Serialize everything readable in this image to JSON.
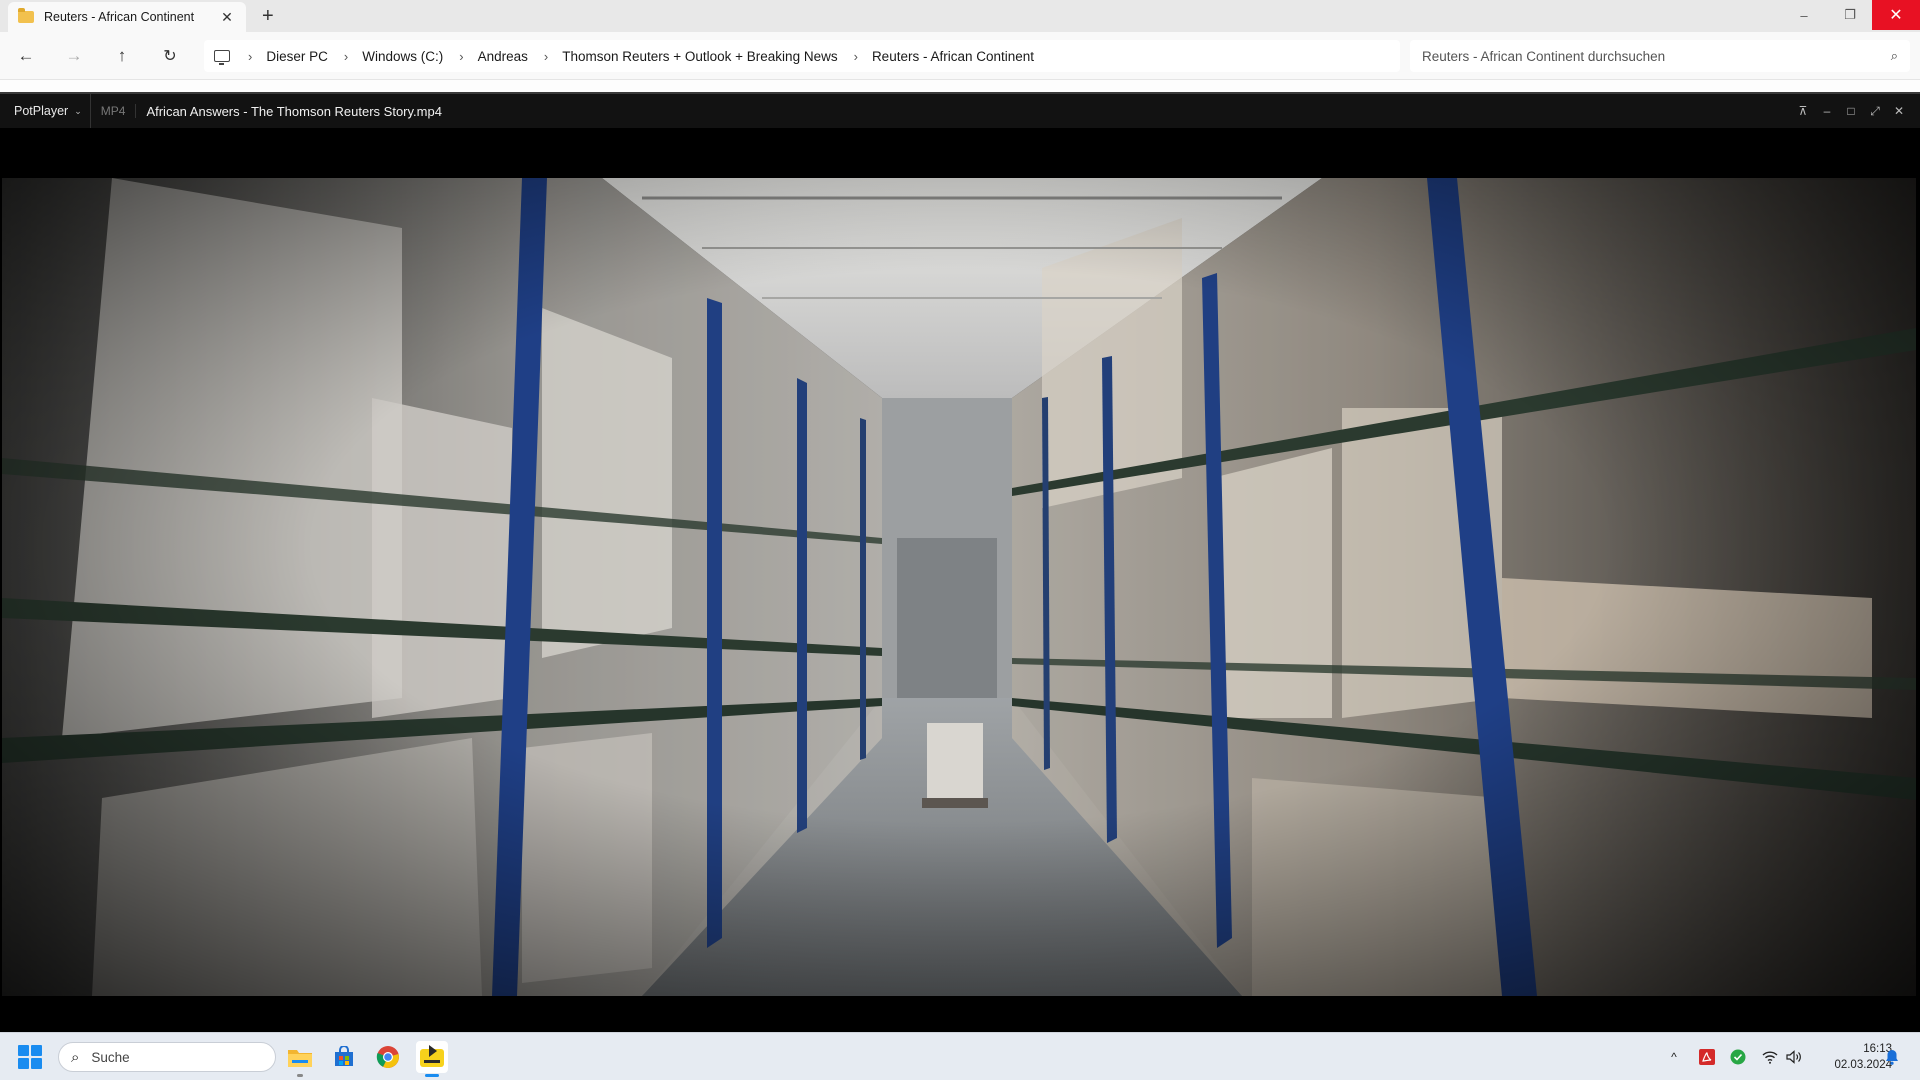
{
  "explorer": {
    "tab_title": "Reuters - African Continent",
    "tab_close": "✕",
    "new_tab": "+",
    "window_controls": {
      "minimize": "–",
      "restore": "❐",
      "close": "✕"
    },
    "nav": {
      "back": "←",
      "forward": "→",
      "up": "↑",
      "refresh": "↻"
    },
    "breadcrumb": [
      "Dieser PC",
      "Windows (C:)",
      "Andreas",
      "Thomson Reuters + Outlook + Breaking News",
      "Reuters - African Continent"
    ],
    "crumb_separator": "›",
    "search_placeholder": "Reuters - African Continent durchsuchen",
    "search_icon": "⌕"
  },
  "player": {
    "menu_label": "PotPlayer",
    "menu_chevron": "⌄",
    "format": "MP4",
    "title": "African Answers - The Thomson Reuters Story.mp4",
    "controls": {
      "pin": "⊼",
      "minimize": "–",
      "maximize": "□",
      "fullscreen": "⤢",
      "close": "✕"
    },
    "video_scene": "warehouse-aisle"
  },
  "taskbar": {
    "search_label": "Suche",
    "search_icon": "⌕",
    "apps": [
      "file-explorer-icon",
      "microsoft-store-icon",
      "chrome-icon",
      "potplayer-icon"
    ],
    "tray": {
      "chevron": "^",
      "wifi": "wifi-icon",
      "volume": "volume-icon",
      "bell": "bell-icon"
    },
    "time": "16:13",
    "date": "02.03.2024"
  },
  "colors": {
    "close_red": "#e81123",
    "accent_blue": "#1a8cf0",
    "player_bg": "#000000"
  }
}
